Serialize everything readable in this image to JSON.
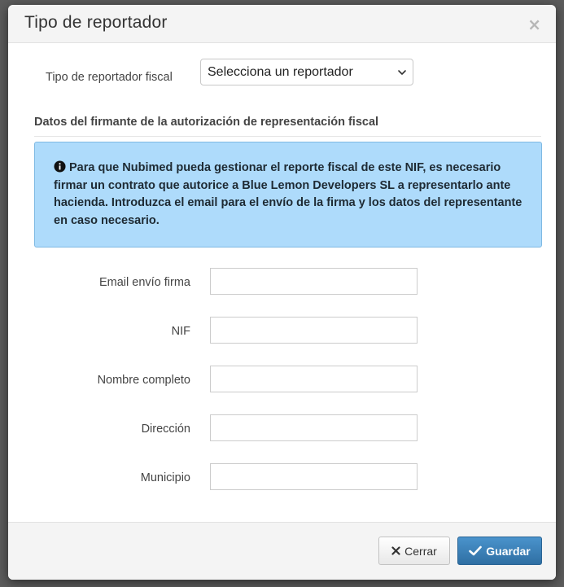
{
  "modal": {
    "title": "Tipo de reportador",
    "close_symbol": "×"
  },
  "reporter": {
    "label": "Tipo de reportador fiscal",
    "selected_value": "Selecciona un reportador"
  },
  "section": {
    "heading": "Datos del firmante de la autorización de representación fiscal"
  },
  "alert": {
    "icon": "info-circle-icon",
    "text": "Para que Nubimed pueda gestionar el reporte fiscal de este NIF, es necesario firmar un contrato que autorice a Blue Lemon Developers SL a representarlo ante hacienda. Introduzca el email para el envío de la firma y los datos del representante en caso necesario.",
    "background": "#aedbfb"
  },
  "fields": [
    {
      "label": "Email envío firma",
      "value": ""
    },
    {
      "label": "NIF",
      "value": ""
    },
    {
      "label": "Nombre completo",
      "value": ""
    },
    {
      "label": "Dirección",
      "value": ""
    },
    {
      "label": "Municipio",
      "value": ""
    }
  ],
  "footer": {
    "cancel_label": "Cerrar",
    "save_label": "Guardar",
    "save_color": "#3b82bb"
  }
}
